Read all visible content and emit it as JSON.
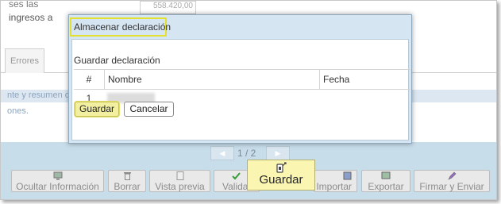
{
  "background": {
    "partial_line_1": "ses las",
    "partial_line_2": "ingresos a",
    "partial_amount": "558.420,00",
    "tab_label": "Errores",
    "band_text": "nte y resumen d",
    "text_2": "ones."
  },
  "pager": {
    "prev_icon": "◀",
    "next_icon": "▶",
    "text": "1 / 2"
  },
  "toolbar": {
    "ocultar": "Ocultar Información",
    "borrar": "Borrar",
    "vista_previa": "Vista previa",
    "validar": "Validar",
    "importar": "Importar",
    "exportar": "Exportar",
    "firmar": "Firmar y Enviar"
  },
  "modal": {
    "title": "Almacenar declaración",
    "subtitle": "Guardar declaración",
    "columns": [
      "#",
      "Nombre",
      "Fecha"
    ],
    "rows": [
      {
        "num": "1",
        "nombre": "",
        "fecha": ""
      }
    ],
    "save_label": "Guardar",
    "cancel_label": "Cancelar"
  },
  "tooltip": {
    "icon": "save-document-icon",
    "label": "Guardar"
  },
  "colors": {
    "modal_header": "#d6e5f2",
    "highlight": "#e3e02f",
    "toolbar_bg": "#c7dde9",
    "tooltip_bg": "#faf5b0"
  }
}
